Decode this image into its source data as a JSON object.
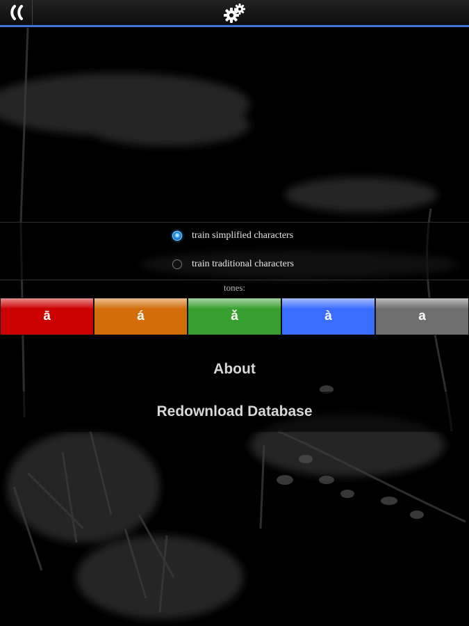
{
  "header": {
    "back_icon": "double-chevron-left-icon",
    "settings_icon": "gears-icon"
  },
  "character_options": {
    "selected": "simplified",
    "items": [
      {
        "label": "train simplified characters",
        "checked": true
      },
      {
        "label": "train traditional characters",
        "checked": false
      }
    ]
  },
  "tones": {
    "label": "tones:",
    "items": [
      {
        "label": "ā",
        "color": "#cc0000"
      },
      {
        "label": "á",
        "color": "#d26d0a"
      },
      {
        "label": "ǎ",
        "color": "#37a030"
      },
      {
        "label": "à",
        "color": "#3a6cff"
      },
      {
        "label": "a",
        "color": "#6e6e6e"
      }
    ]
  },
  "actions": {
    "about_label": "About",
    "redownload_label": "Redownload Database"
  }
}
